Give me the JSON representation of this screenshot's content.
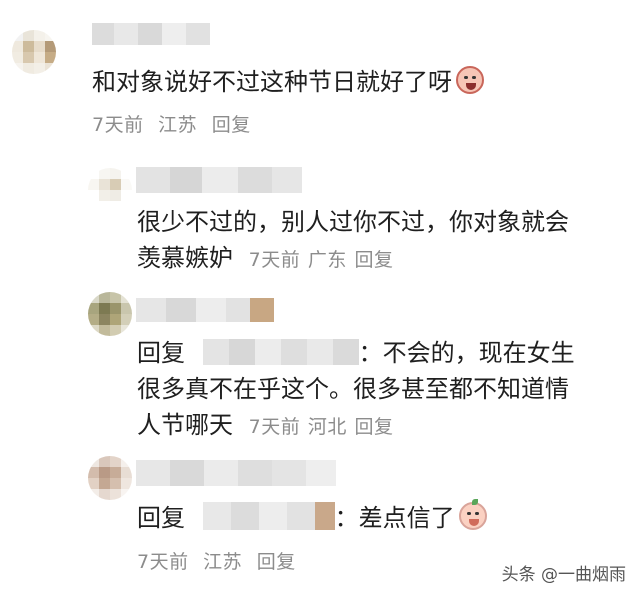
{
  "comments": [
    {
      "text": "和对象说好不过这种节日就好了呀",
      "emoji": "exhausted-face-emoji",
      "meta": {
        "time": "7天前",
        "location": "江苏",
        "reply": "回复"
      }
    },
    {
      "text_line1": "很少不过的，别人过你不过，你对象就会",
      "text_line2": "羡慕嫉妒",
      "meta": {
        "time": "7天前",
        "location": "广东",
        "reply": "回复"
      }
    },
    {
      "reply_prefix": "回复",
      "text_tail1": "：不会的，现在女生",
      "text_line2": "很多真不在乎这个。很多甚至都不知道情",
      "text_line3": "人节哪天",
      "meta": {
        "time": "7天前",
        "location": "河北",
        "reply": "回复"
      }
    },
    {
      "reply_prefix": "回复",
      "text_tail": "：差点信了",
      "emoji": "baby-face-emoji",
      "meta": {
        "time": "7天前",
        "location": "江苏",
        "reply": "回复"
      }
    }
  ],
  "watermark": "头条 @一曲烟雨"
}
